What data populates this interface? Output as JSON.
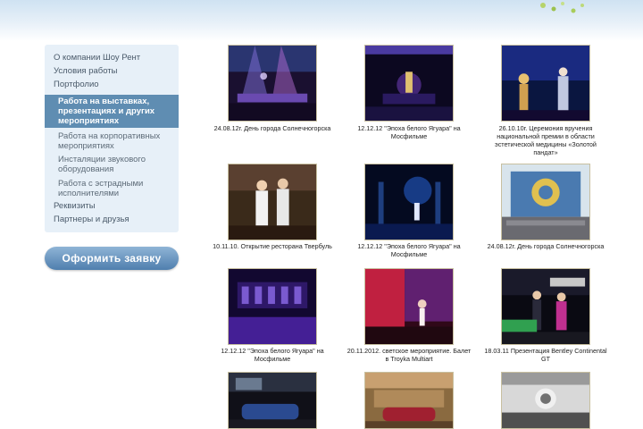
{
  "sidebar": {
    "items": [
      {
        "label": "О компании Шоу Рент"
      },
      {
        "label": "Условия работы"
      },
      {
        "label": "Портфолио"
      },
      {
        "label": "Работа на выставках, презентациях и других мероприятиях"
      },
      {
        "label": "Работа на корпоративных мероприятиях"
      },
      {
        "label": "Инсталяции звукового оборудования"
      },
      {
        "label": "Работа с эстрадными исполнителями"
      },
      {
        "label": "Реквизиты"
      },
      {
        "label": "Партнеры и друзья"
      }
    ],
    "order_button": "Оформить заявку"
  },
  "gallery": {
    "items": [
      {
        "caption": "24.08.12г. День города Солнечногорска",
        "scene": "concert-stage"
      },
      {
        "caption": "12.12.12 \"Эпоха белого Ягуара\" на Мосфильме",
        "scene": "dark-hall-purple"
      },
      {
        "caption": "26.10.10г. Церемония вручения национальной премии в области эстетической медицины «Золотой пандат»",
        "scene": "ceremony-stage"
      },
      {
        "caption": "10.11.10. Открытие ресторана Твербуль",
        "scene": "restaurant-hosts"
      },
      {
        "caption": "12.12.12 \"Эпоха белого Ягуара\" на Мосфильме",
        "scene": "blue-stage-presenter"
      },
      {
        "caption": "24.08.12г. День города Солнечногорска",
        "scene": "outdoor-stage"
      },
      {
        "caption": "12.12.12 \"Эпоха белого Ягуара\" на Мосфильме",
        "scene": "purple-lit-hall"
      },
      {
        "caption": "20.11.2012. светское мероприятие. Балет в Troyka Multiart",
        "scene": "red-ballet"
      },
      {
        "caption": "18.03.11 Презентация Bentley Continental GT",
        "scene": "car-presentation"
      },
      {
        "caption": "",
        "scene": "car-showroom-dark"
      },
      {
        "caption": "",
        "scene": "car-showroom-warm"
      },
      {
        "caption": "",
        "scene": "bw-hall"
      }
    ]
  },
  "colors": {
    "sidebar_bg": "#e7f0f8",
    "active_item": "#5f8db2",
    "button": "#5f8db2"
  }
}
